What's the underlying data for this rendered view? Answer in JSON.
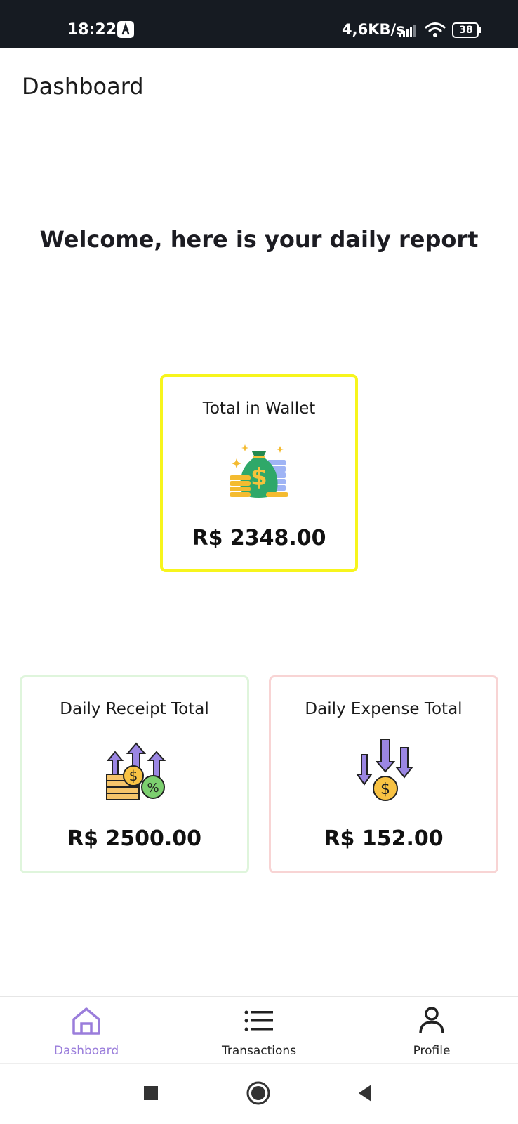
{
  "status_bar": {
    "time": "18:22",
    "network_speed": "4,6KB/s",
    "battery": "38",
    "icons": [
      "app-notification-icon",
      "signal-icon",
      "wifi-icon",
      "battery-icon"
    ]
  },
  "header": {
    "title": "Dashboard"
  },
  "welcome": {
    "text": "Welcome, here is your daily report"
  },
  "cards": {
    "wallet": {
      "title": "Total in Wallet",
      "value": "R$ 2348.00",
      "icon": "money-bag-icon",
      "border_color": "#f7f51d"
    },
    "receipt": {
      "title": "Daily Receipt Total",
      "value": "R$ 2500.00",
      "icon": "income-arrows-icon",
      "border_color": "#dff5dc"
    },
    "expense": {
      "title": "Daily Expense Total",
      "value": "R$ 152.00",
      "icon": "expense-arrows-icon",
      "border_color": "#f8d4d4"
    }
  },
  "bottom_nav": {
    "active": "Dashboard",
    "accent_color": "#9a7ddb",
    "items": [
      {
        "label": "Dashboard",
        "icon": "home-icon"
      },
      {
        "label": "Transactions",
        "icon": "list-icon"
      },
      {
        "label": "Profile",
        "icon": "person-icon"
      }
    ]
  },
  "system_nav": {
    "buttons": [
      "recent-apps-button",
      "home-button",
      "back-button"
    ]
  }
}
